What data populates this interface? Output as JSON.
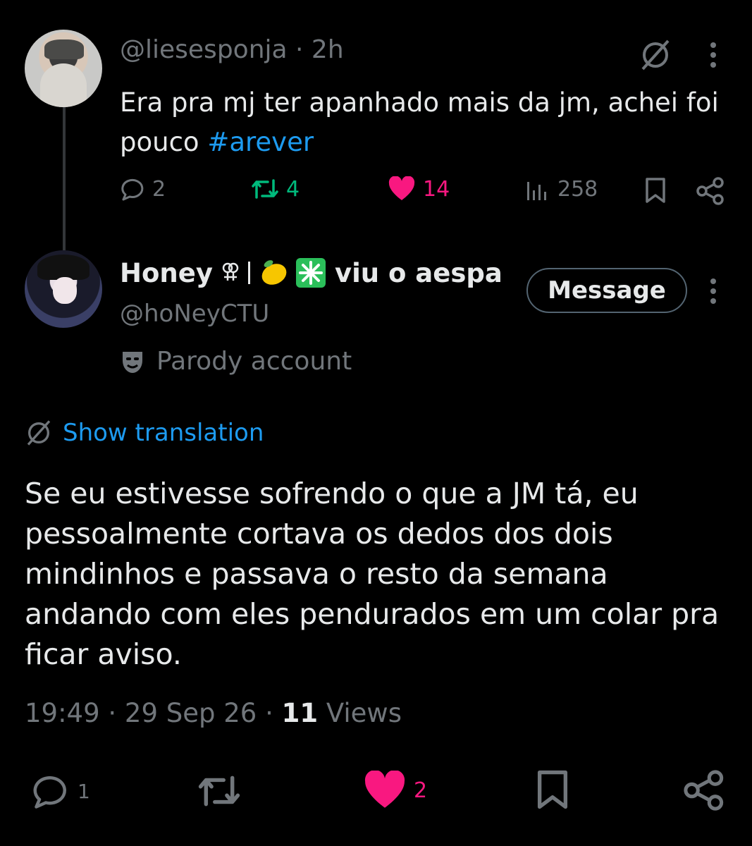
{
  "reply_parent": {
    "handle": "@liesesponja",
    "time": "· 2h",
    "text_plain": "Era pra mj ter apanhado mais da jm, achei foi pouco ",
    "hashtag": "#arever",
    "stats": {
      "replies": "2",
      "reposts": "4",
      "likes": "14",
      "views": "258"
    }
  },
  "main_tweet": {
    "display_name": "Honey",
    "name_suffix": "viu o aespa",
    "handle": "@hoNeyCTU",
    "message_label": "Message",
    "parody_label": "Parody account",
    "translate_label": "Show translation",
    "text": "Se eu estivesse sofrendo o que a JM tá, eu pessoalmente cortava os dedos dos dois mindinhos e passava o resto da semana andando com eles pendurados em um colar pra ficar aviso.",
    "timestamp": "19:49 · 29 Sep 26 · ",
    "views_count": "11",
    "views_label": " Views",
    "stats": {
      "replies": "1",
      "likes": "2"
    }
  },
  "colors": {
    "background": "#000000",
    "text": "#e7e9ea",
    "muted": "#71767b",
    "link": "#1d9bf0",
    "like": "#f91880",
    "repost": "#00ba7c"
  },
  "icons": [
    "translate-icon",
    "more-icon",
    "reply-icon",
    "repost-icon",
    "heart-icon",
    "views-icon",
    "bookmark-icon",
    "share-icon",
    "parody-mask-icon",
    "female-symbol-icon",
    "lemon-emoji",
    "sparkle-emoji"
  ]
}
